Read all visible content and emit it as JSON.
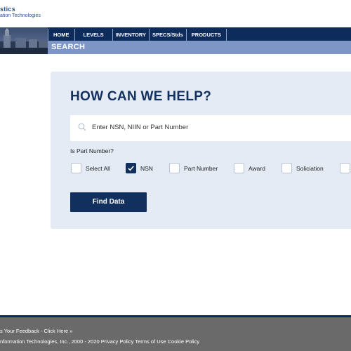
{
  "logo": {
    "line1": "stics",
    "line2": "ation Technologies"
  },
  "nav": {
    "items": [
      {
        "label": "HOME"
      },
      {
        "label": "LEVELS"
      },
      {
        "label": "INVENTORY"
      },
      {
        "label": "SPECS/Stds"
      },
      {
        "label": "PRODUCTS"
      }
    ]
  },
  "subbar": {
    "title": "SEARCH"
  },
  "search": {
    "heading": "HOW CAN WE HELP?",
    "placeholder": "Enter NSN, NIIN or Part Number",
    "is_part_label": "Is Part Number?",
    "options": [
      {
        "label": "Select All",
        "checked": false
      },
      {
        "label": "NSN",
        "checked": true
      },
      {
        "label": "Part Number",
        "checked": false
      },
      {
        "label": "Award",
        "checked": false
      },
      {
        "label": "Soliciation",
        "checked": false
      },
      {
        "label": "",
        "checked": false
      }
    ],
    "find_button": "Find Data"
  },
  "footer": {
    "feedback": "s Your Feedback - Click Here »",
    "copyright": "nformation Technologies, Inc., 2000 - 2020",
    "links": [
      "Privacy Policy",
      "Terms of Use",
      "Cookie Policy"
    ]
  },
  "colors": {
    "navy": "#12305e",
    "nav_bar": "#0d2b5b",
    "subbar": "#7e96c6",
    "panel": "#e4ebf5",
    "footer": "#6a6a6a",
    "logo_blue": "#27529a"
  }
}
